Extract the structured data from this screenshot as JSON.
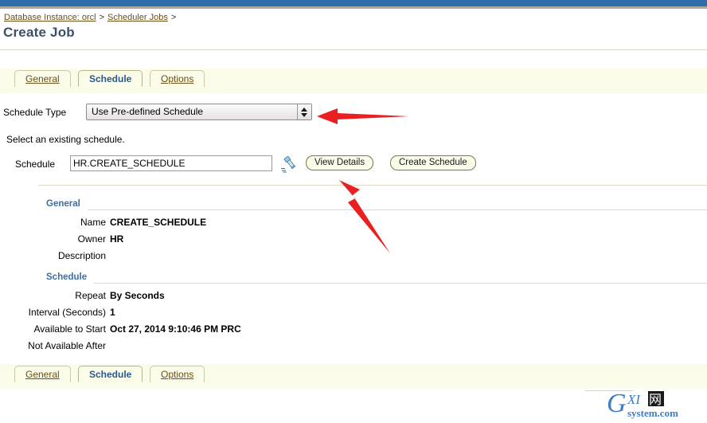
{
  "window": {
    "accent_bar_color": "#2e6ba8",
    "shadow_bar_color": "#a8a8a0"
  },
  "breadcrumb": {
    "items": [
      {
        "label": "Database Instance: orcl",
        "separator": ">"
      },
      {
        "label": "Scheduler Jobs",
        "separator": ">"
      }
    ]
  },
  "page": {
    "title": "Create Job"
  },
  "tabs_top": {
    "items": [
      {
        "label": "General",
        "active": false
      },
      {
        "label": "Schedule",
        "active": true
      },
      {
        "label": "Options",
        "active": false
      }
    ]
  },
  "tabs_bottom": {
    "items": [
      {
        "label": "General",
        "active": false
      },
      {
        "label": "Schedule",
        "active": true
      },
      {
        "label": "Options",
        "active": false
      }
    ]
  },
  "form": {
    "schedule_type_label": "Schedule Type",
    "schedule_type_value": "Use Pre-defined Schedule",
    "hint": "Select an existing schedule.",
    "schedule_label": "Schedule",
    "schedule_value": "HR.CREATE_SCHEDULE",
    "schedule_placeholder": "",
    "torch_icon": "flashlight-icon",
    "view_details_label": "View Details",
    "create_schedule_label": "Create Schedule"
  },
  "details": {
    "general": {
      "heading": "General",
      "rows": [
        {
          "label": "Name",
          "value": "CREATE_SCHEDULE"
        },
        {
          "label": "Owner",
          "value": "HR"
        },
        {
          "label": "Description",
          "value": ""
        }
      ]
    },
    "schedule": {
      "heading": "Schedule",
      "rows": [
        {
          "label": "Repeat",
          "value": "By Seconds"
        },
        {
          "label": "Interval (Seconds)",
          "value": "1"
        },
        {
          "label": "Available to Start",
          "value": "Oct 27, 2014 9:10:46 PM PRC"
        },
        {
          "label": "Not Available After",
          "value": ""
        }
      ]
    }
  },
  "annotations": {
    "color": "#e8201f",
    "arrow_schedule_type": "points-left-at-schedule-type-dropdown",
    "arrow_view_details": "points-up-left-at-view-details-button"
  },
  "watermark": {
    "main": "GXI",
    "cjk": "网",
    "sub": "system.com",
    "color": "#3f7ec4"
  }
}
